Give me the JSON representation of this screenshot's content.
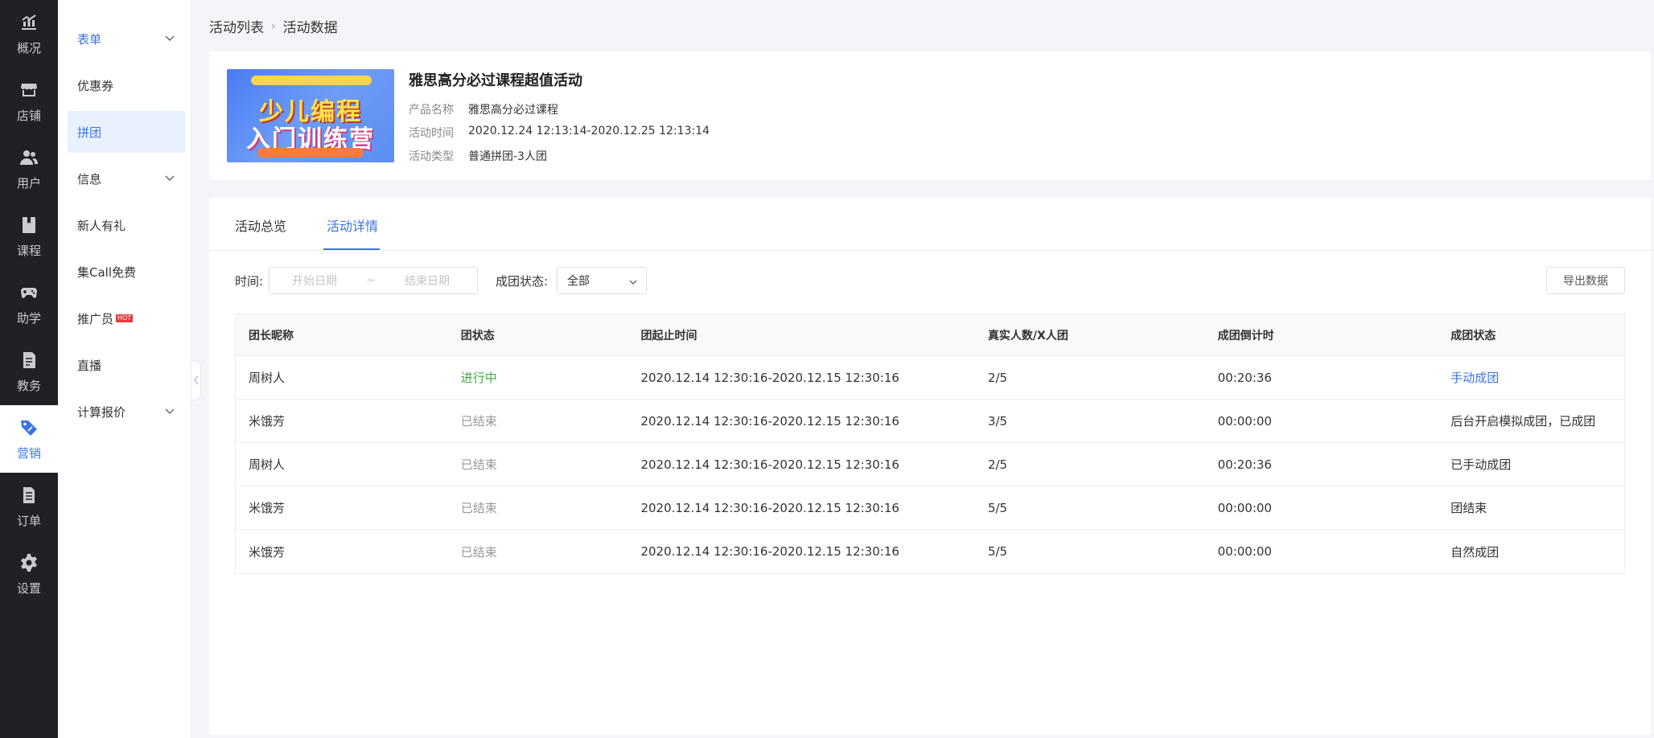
{
  "rail": {
    "items": [
      {
        "label": "概况",
        "icon": "chart-icon"
      },
      {
        "label": "店铺",
        "icon": "store-icon"
      },
      {
        "label": "用户",
        "icon": "users-icon"
      },
      {
        "label": "课程",
        "icon": "book-icon"
      },
      {
        "label": "助学",
        "icon": "gamepad-icon"
      },
      {
        "label": "教务",
        "icon": "document-icon"
      },
      {
        "label": "营销",
        "icon": "tag-icon"
      },
      {
        "label": "订单",
        "icon": "order-icon"
      },
      {
        "label": "设置",
        "icon": "gear-icon"
      }
    ],
    "active_index": 6
  },
  "submenu": {
    "items": [
      {
        "label": "表单"
      },
      {
        "label": "优惠券"
      },
      {
        "label": "拼团"
      },
      {
        "label": "信息"
      },
      {
        "label": "新人有礼"
      },
      {
        "label": "集Call免费"
      },
      {
        "label": "推广员",
        "badge": "HOT"
      },
      {
        "label": "直播"
      },
      {
        "label": "计算报价"
      }
    ]
  },
  "breadcrumb": {
    "items": [
      "活动列表",
      "活动数据"
    ],
    "separator": "›"
  },
  "activity": {
    "title": "雅思高分必过课程超值活动",
    "image": {
      "line1": "少儿编程",
      "line2": "入门训练营"
    },
    "fields": [
      {
        "key": "产品名称",
        "value": "雅思高分必过课程"
      },
      {
        "key": "活动时间",
        "value": "2020.12.24 12:13:14-2020.12.25 12:13:14"
      },
      {
        "key": "活动类型",
        "value": "普通拼团-3人团"
      }
    ]
  },
  "tabs": [
    {
      "label": "活动总览"
    },
    {
      "label": "活动详情"
    }
  ],
  "active_tab": 1,
  "filters": {
    "time_label": "时间:",
    "start_placeholder": "开始日期",
    "range_sep": "~",
    "end_placeholder": "结束日期",
    "status_label": "成团状态:",
    "status_value": "全部",
    "export_label": "导出数据"
  },
  "table": {
    "headers": [
      "团长昵称",
      "团状态",
      "团起止时间",
      "真实人数/X人团",
      "成团倒计时",
      "成团状态"
    ],
    "rows": [
      {
        "leader": "周树人",
        "state": "进行中",
        "state_type": "active",
        "period": "2020.12.14 12:30:16-2020.12.15 12:30:16",
        "count": "2/5",
        "countdown": "00:20:36",
        "result": "手动成团",
        "result_type": "link"
      },
      {
        "leader": "米饿芳",
        "state": "已结束",
        "state_type": "ended",
        "period": "2020.12.14 12:30:16-2020.12.15 12:30:16",
        "count": "3/5",
        "countdown": "00:00:00",
        "result": "后台开启模拟成团，已成团",
        "result_type": "text"
      },
      {
        "leader": "周树人",
        "state": "已结束",
        "state_type": "ended",
        "period": "2020.12.14 12:30:16-2020.12.15 12:30:16",
        "count": "2/5",
        "countdown": "00:20:36",
        "result": "已手动成团",
        "result_type": "text"
      },
      {
        "leader": "米饿芳",
        "state": "已结束",
        "state_type": "ended",
        "period": "2020.12.14 12:30:16-2020.12.15 12:30:16",
        "count": "5/5",
        "countdown": "00:00:00",
        "result": "团结束",
        "result_type": "text"
      },
      {
        "leader": "米饿芳",
        "state": "已结束",
        "state_type": "ended",
        "period": "2020.12.14 12:30:16-2020.12.15 12:30:16",
        "count": "5/5",
        "countdown": "00:00:00",
        "result": "自然成团",
        "result_type": "text"
      }
    ]
  },
  "colors": {
    "accent": "#3b74e6",
    "active_status": "#3cb043",
    "rail_bg": "#1f2124"
  }
}
